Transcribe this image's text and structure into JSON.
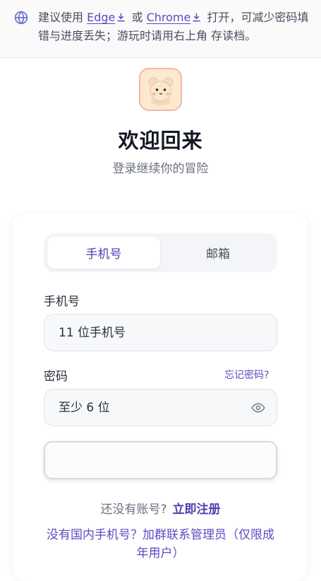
{
  "notice": {
    "prefix": "建议使用",
    "edge_link": "Edge",
    "or": "或",
    "chrome_link": "Chrome",
    "suffix": "打开，可减少密码填错与进度丢失；游玩时请用右上角 存读档。"
  },
  "header": {
    "title": "欢迎回来",
    "subtitle": "登录继续你的冒险"
  },
  "tabs": [
    {
      "label": "手机号",
      "active": true
    },
    {
      "label": "邮箱",
      "active": false
    }
  ],
  "form": {
    "phone_label": "手机号",
    "phone_placeholder": "11 位手机号",
    "password_label": "密码",
    "forgot_label": "忘记密码?",
    "password_placeholder": "至少 6 位"
  },
  "footer": {
    "no_account": "还没有账号?",
    "register": "立即注册",
    "contact": "没有国内手机号？加群联系管理员（仅限成年用户）"
  },
  "colors": {
    "accent": "#5b4bc4",
    "field_bg": "#f7f8fa",
    "logo_bg": "#fde9cf"
  }
}
